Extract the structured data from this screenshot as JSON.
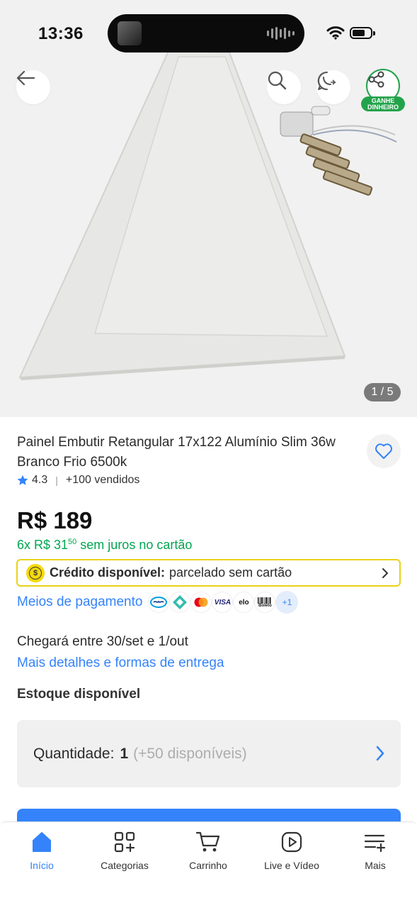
{
  "status_bar": {
    "time": "13:36"
  },
  "gallery": {
    "counter": "1 / 5",
    "earn_badge_line1": "GANHE",
    "earn_badge_line2": "DINHEIRO"
  },
  "product": {
    "title": "Painel Embutir Retangular 17x122 Alumínio Slim 36w Branco Frio 6500k",
    "rating": "4.3",
    "sold": "+100 vendidos",
    "price": "R$ 189",
    "installments_prefix": "6x R$ 31",
    "installments_cents": "50",
    "installments_suffix": " sem juros no cartão"
  },
  "credit": {
    "label": "Crédito disponível:",
    "text": "parcelado sem cartão"
  },
  "payment": {
    "link": "Meios de pagamento",
    "icons": [
      "mercado-pago-icon",
      "pix-icon",
      "mastercard-icon",
      "visa-icon",
      "elo-icon",
      "boleto-icon"
    ],
    "visa": "VISA",
    "elo": "elo",
    "boleto": "Boleto",
    "more": "+1"
  },
  "delivery": {
    "text": "Chegará entre 30/set e 1/out",
    "link": "Mais detalhes e formas de entrega"
  },
  "stock": {
    "label": "Estoque disponível"
  },
  "quantity": {
    "label": "Quantidade:",
    "value": "1",
    "available": "(+50 disponíveis)"
  },
  "nav": [
    {
      "label": "Início",
      "icon": "home-icon",
      "active": true
    },
    {
      "label": "Categorias",
      "icon": "categories-icon"
    },
    {
      "label": "Carrinho",
      "icon": "cart-icon"
    },
    {
      "label": "Live e Vídeo",
      "icon": "play-icon"
    },
    {
      "label": "Mais",
      "icon": "menu-icon"
    }
  ],
  "colors": {
    "accent": "#3483fa",
    "green": "#00a650",
    "credit_border": "#e8d21a"
  }
}
